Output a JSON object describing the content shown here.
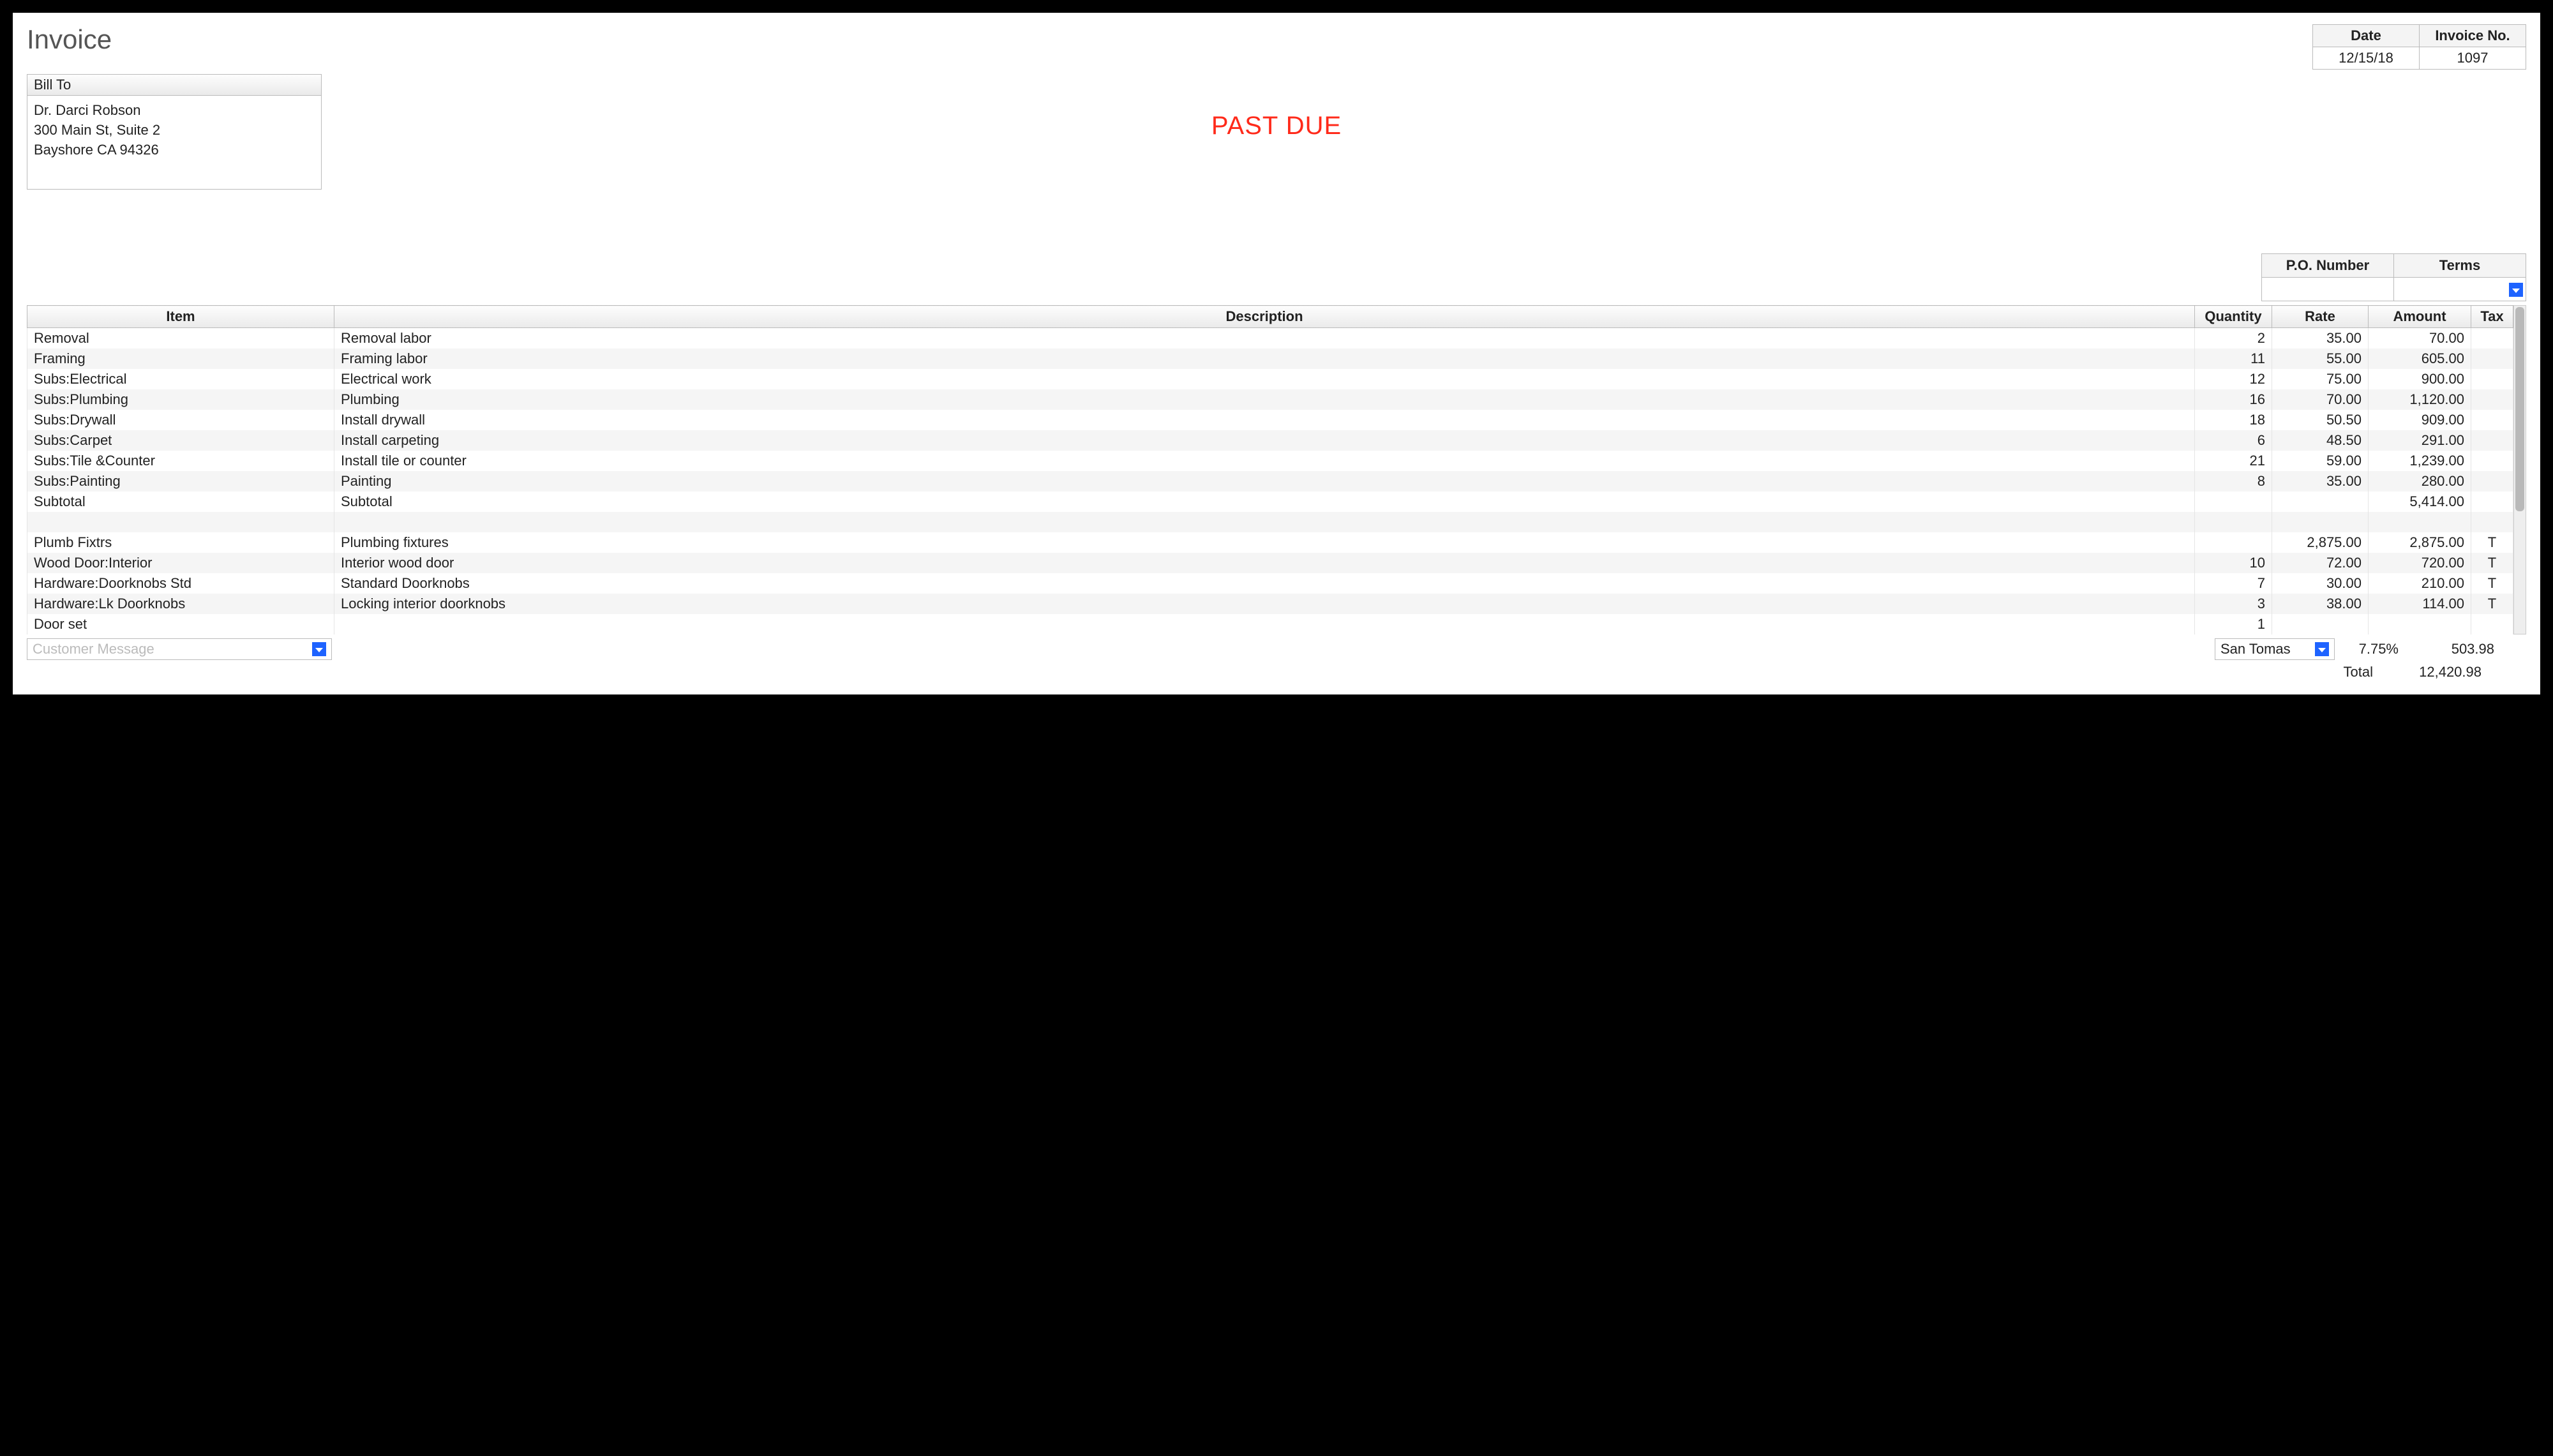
{
  "title": "Invoice",
  "header": {
    "date_label": "Date",
    "date_value": "12/15/18",
    "inv_no_label": "Invoice No.",
    "inv_no_value": "1097"
  },
  "bill_to": {
    "label": "Bill To",
    "line1": "Dr. Darci Robson",
    "line2": "300 Main St, Suite 2",
    "line3": "Bayshore CA 94326"
  },
  "stamp": "PAST DUE",
  "po_terms": {
    "po_label": "P.O. Number",
    "po_value": "",
    "terms_label": "Terms",
    "terms_value": ""
  },
  "columns": {
    "item": "Item",
    "desc": "Description",
    "qty": "Quantity",
    "rate": "Rate",
    "amt": "Amount",
    "tax": "Tax"
  },
  "lines": [
    {
      "item": "Removal",
      "desc": "Removal labor",
      "qty": "2",
      "rate": "35.00",
      "amt": "70.00",
      "tax": ""
    },
    {
      "item": "Framing",
      "desc": "Framing labor",
      "qty": "11",
      "rate": "55.00",
      "amt": "605.00",
      "tax": ""
    },
    {
      "item": "Subs:Electrical",
      "desc": "Electrical work",
      "qty": "12",
      "rate": "75.00",
      "amt": "900.00",
      "tax": ""
    },
    {
      "item": "Subs:Plumbing",
      "desc": "Plumbing",
      "qty": "16",
      "rate": "70.00",
      "amt": "1,120.00",
      "tax": ""
    },
    {
      "item": "Subs:Drywall",
      "desc": "Install drywall",
      "qty": "18",
      "rate": "50.50",
      "amt": "909.00",
      "tax": ""
    },
    {
      "item": "Subs:Carpet",
      "desc": "Install carpeting",
      "qty": "6",
      "rate": "48.50",
      "amt": "291.00",
      "tax": ""
    },
    {
      "item": "Subs:Tile &Counter",
      "desc": "Install tile or counter",
      "qty": "21",
      "rate": "59.00",
      "amt": "1,239.00",
      "tax": ""
    },
    {
      "item": "Subs:Painting",
      "desc": "Painting",
      "qty": "8",
      "rate": "35.00",
      "amt": "280.00",
      "tax": ""
    },
    {
      "item": "Subtotal",
      "desc": "Subtotal",
      "qty": "",
      "rate": "",
      "amt": "5,414.00",
      "tax": ""
    },
    {
      "item": "",
      "desc": "",
      "qty": "",
      "rate": "",
      "amt": "",
      "tax": ""
    },
    {
      "item": "Plumb Fixtrs",
      "desc": "Plumbing fixtures",
      "qty": "",
      "rate": "2,875.00",
      "amt": "2,875.00",
      "tax": "T"
    },
    {
      "item": "Wood Door:Interior",
      "desc": "Interior wood door",
      "qty": "10",
      "rate": "72.00",
      "amt": "720.00",
      "tax": "T"
    },
    {
      "item": "Hardware:Doorknobs Std",
      "desc": "Standard Doorknobs",
      "qty": "7",
      "rate": "30.00",
      "amt": "210.00",
      "tax": "T"
    },
    {
      "item": "Hardware:Lk Doorknobs",
      "desc": "Locking interior doorknobs",
      "qty": "3",
      "rate": "38.00",
      "amt": "114.00",
      "tax": "T"
    },
    {
      "item": "Door set",
      "desc": "",
      "qty": "1",
      "rate": "",
      "amt": "",
      "tax": ""
    }
  ],
  "footer": {
    "cust_msg_placeholder": "Customer Message",
    "tax_location": "San Tomas",
    "tax_rate": "7.75%",
    "tax_amount": "503.98",
    "total_label": "Total",
    "total_value": "12,420.98"
  }
}
